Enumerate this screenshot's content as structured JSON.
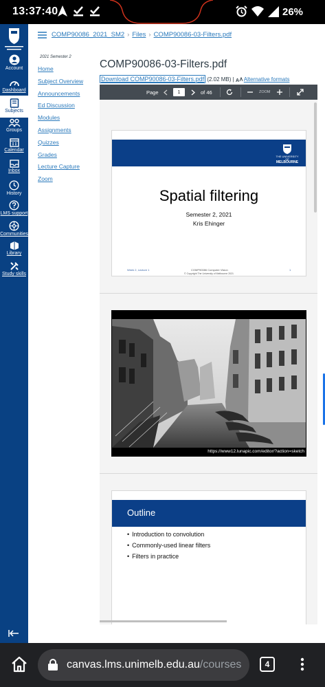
{
  "status": {
    "time": "13:37:40",
    "battery": "26%"
  },
  "nav": {
    "items": [
      {
        "label": "Account"
      },
      {
        "label": "Dashboard"
      },
      {
        "label": "Subjects"
      },
      {
        "label": "Groups"
      },
      {
        "label": "Calendar"
      },
      {
        "label": "Inbox"
      },
      {
        "label": "History"
      },
      {
        "label": "LMS support"
      },
      {
        "label": "Communities"
      },
      {
        "label": "Library"
      },
      {
        "label": "Study skills"
      }
    ],
    "logo_text": "THE UNIVERSITY OF MELBOURNE"
  },
  "breadcrumb": [
    "COMP90086_2021_SM2",
    "Files",
    "COMP90086-03-Filters.pdf"
  ],
  "course_nav": {
    "term": "2021 Semester 2",
    "links": [
      "Home",
      "Subject Overview",
      "Announcements",
      "Ed Discussion",
      "Modules",
      "Assignments",
      "Quizzes",
      "Grades",
      "Lecture Capture",
      "Zoom"
    ]
  },
  "file": {
    "title": "COMP90086-03-Filters.pdf",
    "download_label": "Download COMP90086-03-Filters.pdf",
    "size": "(2.02 MB)",
    "alt_formats": "Alternative formats"
  },
  "viewer": {
    "page_label": "Page",
    "current_page": "1",
    "of_pages": "of 46",
    "zoom_label": "ZOOM"
  },
  "slides": {
    "s1": {
      "uni": [
        "THE UNIVERSITY OF",
        "MELBOURNE"
      ],
      "title": "Spatial filtering",
      "semester": "Semester 2, 2021",
      "author": "Kris Ehinger",
      "footer_left": "Week 2, Lecture 1",
      "footer_center": "COMP90086 Computer Vision",
      "footer_right": "1",
      "copyright": "© Copyright The University of Melbourne 2021"
    },
    "s2": {
      "url": "https://www12.lunapic.com/editor/?action=sketch"
    },
    "s3": {
      "title": "Outline",
      "bullets": [
        "Introduction to convolution",
        "Commonly-used linear filters",
        "Filters in practice"
      ]
    }
  },
  "browser": {
    "domain": "canvas.lms.unimelb.edu.au",
    "path": "/courses",
    "tab_count": "4"
  },
  "colors": {
    "nav_bg": "#094183",
    "link": "#2b7abc",
    "slide_band": "#0b3f88",
    "toolbar": "#444b52"
  }
}
